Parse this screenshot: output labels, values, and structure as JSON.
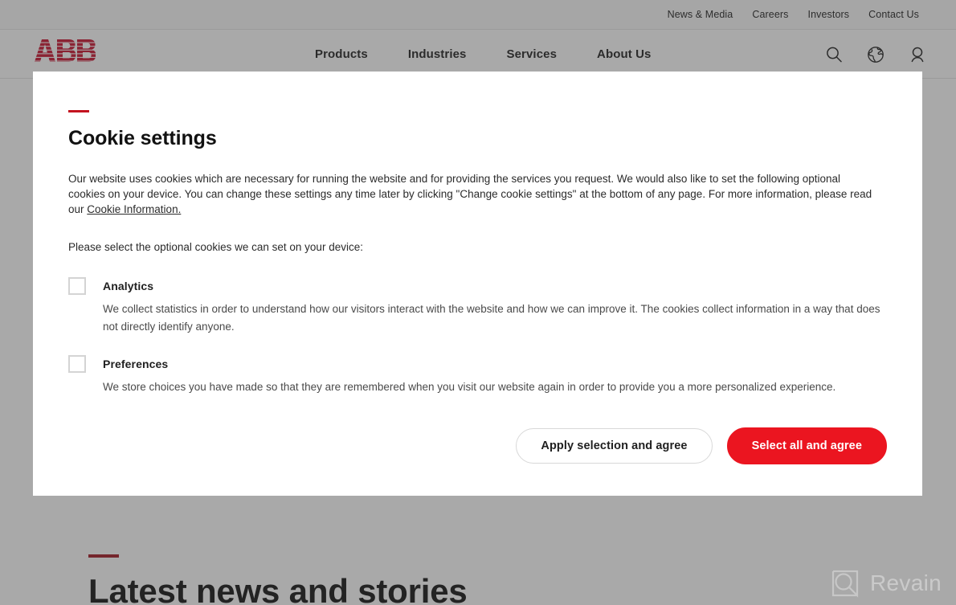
{
  "utility_bar": {
    "links": [
      {
        "label": "News & Media"
      },
      {
        "label": "Careers"
      },
      {
        "label": "Investors"
      },
      {
        "label": "Contact Us"
      }
    ]
  },
  "header": {
    "logo_text": "ABB",
    "nav_links": [
      {
        "label": "Products"
      },
      {
        "label": "Industries"
      },
      {
        "label": "Services"
      },
      {
        "label": "About Us"
      }
    ],
    "icons": [
      {
        "name": "search-icon"
      },
      {
        "name": "globe-icon"
      },
      {
        "name": "user-icon"
      }
    ]
  },
  "page_content": {
    "section_heading": "Latest news and stories"
  },
  "cookie_modal": {
    "title": "Cookie settings",
    "intro_part1": "Our website uses cookies which are necessary for running the website and for providing the services you request. We would also like to set the following optional cookies on your device. You can change these settings any time later by clicking \"Change cookie settings\" at the bottom of any page. For more information, please read our ",
    "intro_link": "Cookie Information.",
    "select_prompt": "Please select the optional cookies we can set on your device:",
    "options": [
      {
        "label": "Analytics",
        "description": "We collect statistics in order to understand how our visitors interact with the website and how we can improve it. The cookies collect information in a way that does not directly identify anyone.",
        "checked": false
      },
      {
        "label": "Preferences",
        "description": "We store choices you have made so that they are remembered when you visit our website again in order to provide you a more personalized experience.",
        "checked": false
      }
    ],
    "apply_button": "Apply selection and agree",
    "select_all_button": "Select all and agree"
  },
  "watermark": {
    "text": "Revain"
  },
  "colors": {
    "brand_red": "#eb1520",
    "accent_rule_red": "#c3131f",
    "section_rule_red": "#a31621",
    "text_dark": "#1f1f1f",
    "overlay": "rgba(60,60,60,0.44)"
  }
}
